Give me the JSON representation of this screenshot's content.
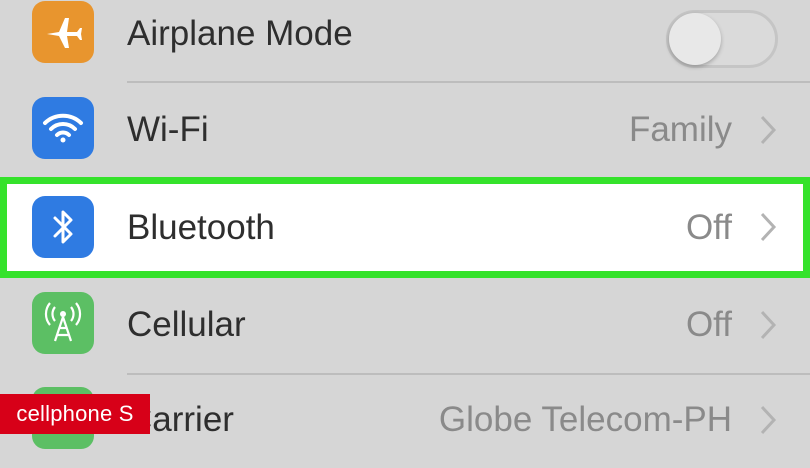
{
  "settings": {
    "rows": [
      {
        "label": "Airplane Mode",
        "icon": "airplane-icon",
        "icon_color": "#e8952e",
        "toggle_on": false
      },
      {
        "label": "Wi-Fi",
        "value": "Family",
        "icon": "wifi-icon",
        "icon_color": "#2f7be2"
      },
      {
        "label": "Bluetooth",
        "value": "Off",
        "icon": "bluetooth-icon",
        "icon_color": "#2f7be2",
        "highlighted": true
      },
      {
        "label": "Cellular",
        "value": "Off",
        "icon": "cellular-antenna-icon",
        "icon_color": "#5cbf64"
      },
      {
        "label": "Carrier",
        "value": "Globe Telecom-PH",
        "icon": "phone-icon",
        "icon_color": "#5cbf64"
      }
    ]
  },
  "highlight_color": "#35e22b",
  "watermark": {
    "text": "cellphone S",
    "color": "#d70018"
  }
}
